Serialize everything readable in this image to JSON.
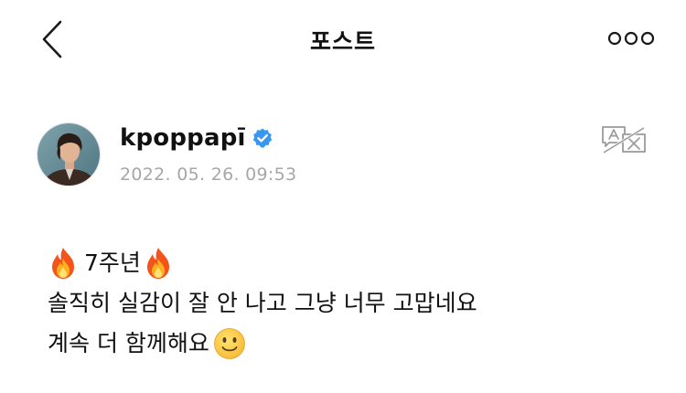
{
  "header": {
    "title": "포스트",
    "back_icon": "chevron-left-icon",
    "more_icon": "more-horizontal-icon"
  },
  "post": {
    "author": {
      "username": "kpoppapī",
      "verified": true,
      "verified_icon": "verified-badge-icon",
      "verified_color": "#3897f0"
    },
    "timestamp": "2022. 05. 26. 09:53",
    "translate_icon": "translate-icon",
    "body": {
      "line1_text": "7주년",
      "line1_emoji": "fire-emoji",
      "line2_text": "솔직히 실감이 잘 안 나고 그냥 너무 고맙네요",
      "line3_text": "계속 더 함께해요",
      "line3_emoji": "slightly-smiling-face-emoji"
    }
  }
}
